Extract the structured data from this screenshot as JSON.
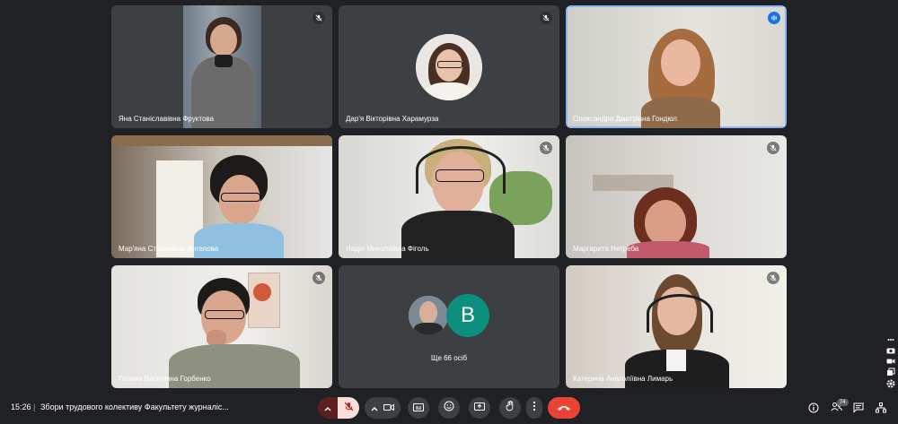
{
  "participants": [
    {
      "name": "Яна Станіславівна Фруктова",
      "muted": true
    },
    {
      "name": "Дар'я Вікторівна Харамурза",
      "muted": true
    },
    {
      "name": "Олександра Дмитрівна Гондюл",
      "speaking": true
    },
    {
      "name": "Мар'яна Степанівна Ангелова",
      "muted": false
    },
    {
      "name": "Надія Миколаївна Фіголь",
      "muted": true
    },
    {
      "name": "Маргарита Нетреба",
      "muted": true
    },
    {
      "name": "Галина Василівна Горбенко",
      "muted": true
    },
    {
      "name": "Катерина Анатоліївна Лимарь",
      "muted": true
    }
  ],
  "others_tile": {
    "letter": "B",
    "label": "Ще 66 осіб"
  },
  "meeting": {
    "time": "15:26",
    "separator": "|",
    "title": "Збори трудового колективу Факультету журналіс..."
  },
  "people_count": "74",
  "colors": {
    "background": "#202124",
    "tile": "#3c4043",
    "end_call": "#ea4335",
    "speaking_border": "#8ab4f8",
    "avatar_letter_bg": "#0d8f7e"
  }
}
